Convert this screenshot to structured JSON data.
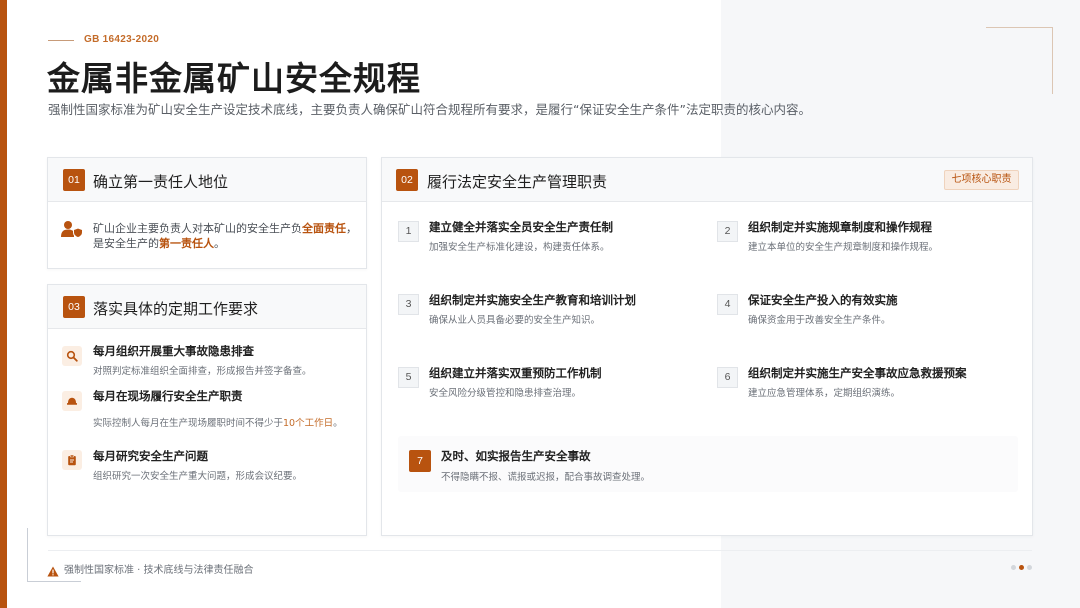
{
  "header": {
    "standard_code": "GB 16423-2020",
    "title": "金属非金属矿山安全规程",
    "subtitle": "强制性国家标准为矿山安全生产设定技术底线，主要负责人确保矿山符合规程所有要求，是履行“保证安全生产条件”法定职责的核心内容。"
  },
  "card1": {
    "number": "01",
    "title": "确立第一责任人地位",
    "text_before": "矿山企业主要负责人对本矿山的安全生产负",
    "highlight1": "全面责任",
    "text_middle": "，是安全生产的",
    "highlight2": "第一责任人",
    "text_after": "。",
    "icon": "user-shield-icon"
  },
  "card3": {
    "number": "03",
    "title": "落实具体的定期工作要求",
    "items": [
      {
        "icon": "search-icon",
        "title": "每月组织开展重大事故隐患排查",
        "desc": "对照判定标准组织全面排查，形成报告并签字备查。"
      },
      {
        "icon": "hardhat-icon",
        "title": "每月在现场履行安全生产职责",
        "desc_before": "实际控制人每月在生产现场履职时间不得少于",
        "desc_highlight": "10个工作日",
        "desc_after": "。"
      },
      {
        "icon": "clipboard-icon",
        "title": "每月研究安全生产问题",
        "desc": "组织研究一次安全生产重大问题，形成会议纪要。"
      }
    ]
  },
  "card2": {
    "number": "02",
    "title": "履行法定安全生产管理职责",
    "tag": "七项核心职责",
    "duties": [
      {
        "n": "1",
        "title": "建立健全并落实全员安全生产责任制",
        "desc": "加强安全生产标准化建设，构建责任体系。"
      },
      {
        "n": "2",
        "title": "组织制定并实施规章制度和操作规程",
        "desc": "建立本单位的安全生产规章制度和操作规程。"
      },
      {
        "n": "3",
        "title": "组织制定并实施安全生产教育和培训计划",
        "desc": "确保从业人员具备必要的安全生产知识。"
      },
      {
        "n": "4",
        "title": "保证安全生产投入的有效实施",
        "desc": "确保资金用于改善安全生产条件。"
      },
      {
        "n": "5",
        "title": "组织建立并落实双重预防工作机制",
        "desc": "安全风险分级管控和隐患排查治理。"
      },
      {
        "n": "6",
        "title": "组织制定并实施生产安全事故应急救援预案",
        "desc": "建立应急管理体系，定期组织演练。"
      },
      {
        "n": "7",
        "title": "及时、如实报告生产安全事故",
        "desc": "不得隐瞒不报、谎报或迟报，配合事故调查处理。"
      }
    ]
  },
  "footer": {
    "icon": "warning-icon",
    "text": "强制性国家标准 · 技术底线与法律责任融合",
    "pagination_active": 2,
    "pagination_total": 3
  },
  "colors": {
    "accent": "#b8530f",
    "accent_light": "#fbeee3",
    "text": "#2b2b2b",
    "muted": "#6b7078"
  }
}
